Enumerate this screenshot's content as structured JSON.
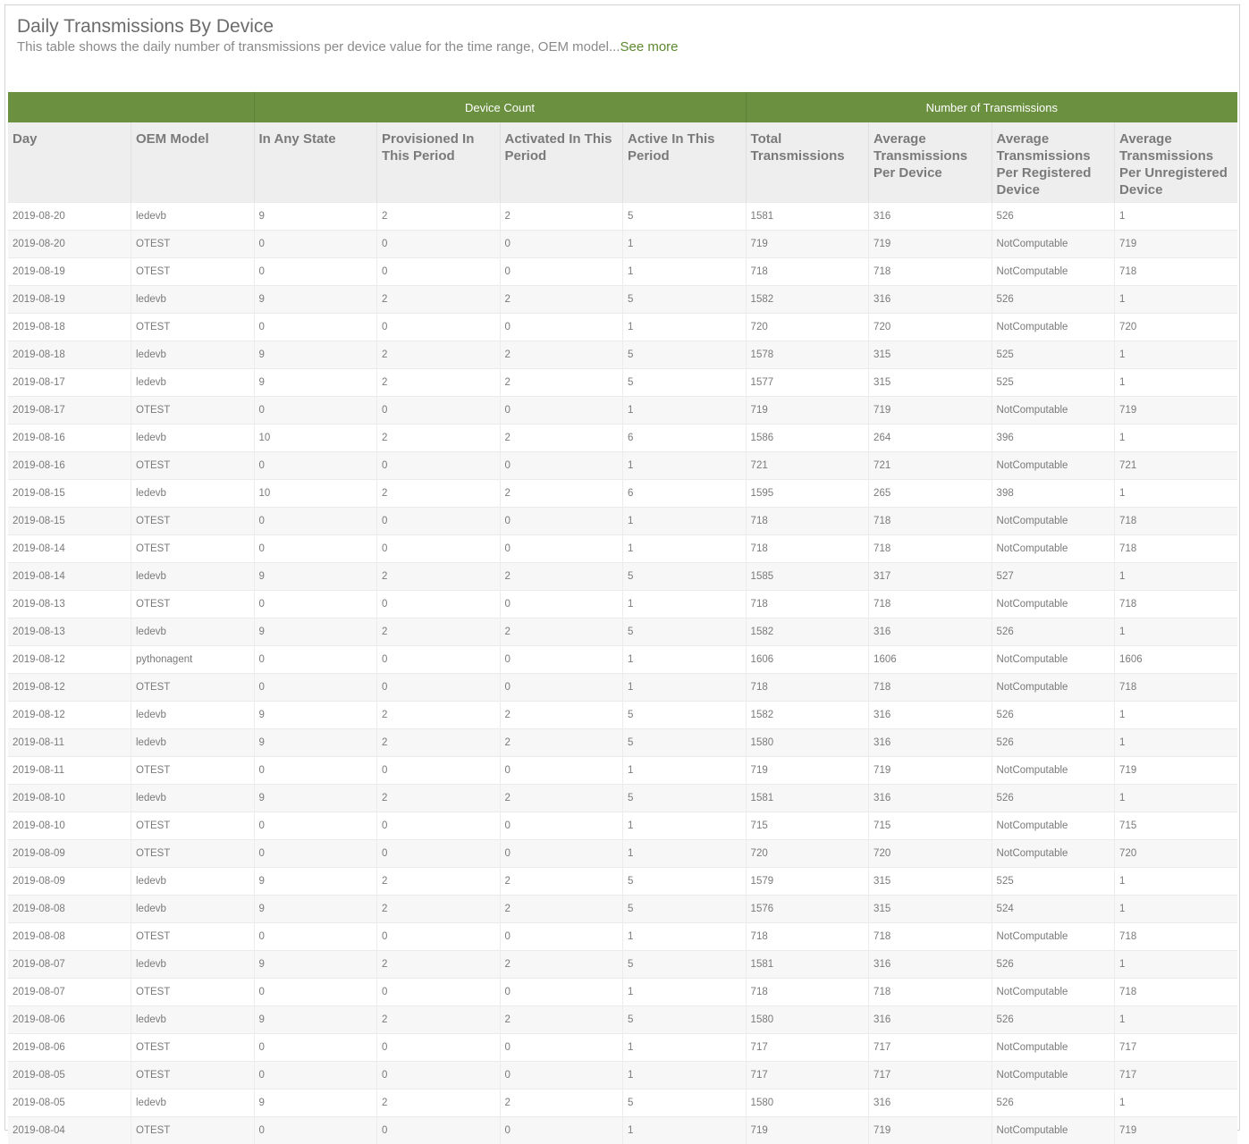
{
  "widget": {
    "title": "Daily Transmissions By Device",
    "description": "This table shows the daily number of transmissions per device value for the time range, OEM model...",
    "see_more": "See more"
  },
  "table": {
    "groups": {
      "device_count": "Device Count",
      "transmissions": "Number of Transmissions"
    },
    "columns": [
      "Day",
      "OEM Model",
      "In Any State",
      "Provisioned In This Period",
      "Activated In This Period",
      "Active In This Period",
      "Total Transmissions",
      "Average Transmissions Per Device",
      "Average Transmissions Per Registered Device",
      "Average Transmissions Per Unregistered Device"
    ],
    "rows": [
      [
        "2019-08-20",
        "ledevb",
        "9",
        "2",
        "2",
        "5",
        "1581",
        "316",
        "526",
        "1"
      ],
      [
        "2019-08-20",
        "OTEST",
        "0",
        "0",
        "0",
        "1",
        "719",
        "719",
        "NotComputable",
        "719"
      ],
      [
        "2019-08-19",
        "OTEST",
        "0",
        "0",
        "0",
        "1",
        "718",
        "718",
        "NotComputable",
        "718"
      ],
      [
        "2019-08-19",
        "ledevb",
        "9",
        "2",
        "2",
        "5",
        "1582",
        "316",
        "526",
        "1"
      ],
      [
        "2019-08-18",
        "OTEST",
        "0",
        "0",
        "0",
        "1",
        "720",
        "720",
        "NotComputable",
        "720"
      ],
      [
        "2019-08-18",
        "ledevb",
        "9",
        "2",
        "2",
        "5",
        "1578",
        "315",
        "525",
        "1"
      ],
      [
        "2019-08-17",
        "ledevb",
        "9",
        "2",
        "2",
        "5",
        "1577",
        "315",
        "525",
        "1"
      ],
      [
        "2019-08-17",
        "OTEST",
        "0",
        "0",
        "0",
        "1",
        "719",
        "719",
        "NotComputable",
        "719"
      ],
      [
        "2019-08-16",
        "ledevb",
        "10",
        "2",
        "2",
        "6",
        "1586",
        "264",
        "396",
        "1"
      ],
      [
        "2019-08-16",
        "OTEST",
        "0",
        "0",
        "0",
        "1",
        "721",
        "721",
        "NotComputable",
        "721"
      ],
      [
        "2019-08-15",
        "ledevb",
        "10",
        "2",
        "2",
        "6",
        "1595",
        "265",
        "398",
        "1"
      ],
      [
        "2019-08-15",
        "OTEST",
        "0",
        "0",
        "0",
        "1",
        "718",
        "718",
        "NotComputable",
        "718"
      ],
      [
        "2019-08-14",
        "OTEST",
        "0",
        "0",
        "0",
        "1",
        "718",
        "718",
        "NotComputable",
        "718"
      ],
      [
        "2019-08-14",
        "ledevb",
        "9",
        "2",
        "2",
        "5",
        "1585",
        "317",
        "527",
        "1"
      ],
      [
        "2019-08-13",
        "OTEST",
        "0",
        "0",
        "0",
        "1",
        "718",
        "718",
        "NotComputable",
        "718"
      ],
      [
        "2019-08-13",
        "ledevb",
        "9",
        "2",
        "2",
        "5",
        "1582",
        "316",
        "526",
        "1"
      ],
      [
        "2019-08-12",
        "pythonagent",
        "0",
        "0",
        "0",
        "1",
        "1606",
        "1606",
        "NotComputable",
        "1606"
      ],
      [
        "2019-08-12",
        "OTEST",
        "0",
        "0",
        "0",
        "1",
        "718",
        "718",
        "NotComputable",
        "718"
      ],
      [
        "2019-08-12",
        "ledevb",
        "9",
        "2",
        "2",
        "5",
        "1582",
        "316",
        "526",
        "1"
      ],
      [
        "2019-08-11",
        "ledevb",
        "9",
        "2",
        "2",
        "5",
        "1580",
        "316",
        "526",
        "1"
      ],
      [
        "2019-08-11",
        "OTEST",
        "0",
        "0",
        "0",
        "1",
        "719",
        "719",
        "NotComputable",
        "719"
      ],
      [
        "2019-08-10",
        "ledevb",
        "9",
        "2",
        "2",
        "5",
        "1581",
        "316",
        "526",
        "1"
      ],
      [
        "2019-08-10",
        "OTEST",
        "0",
        "0",
        "0",
        "1",
        "715",
        "715",
        "NotComputable",
        "715"
      ],
      [
        "2019-08-09",
        "OTEST",
        "0",
        "0",
        "0",
        "1",
        "720",
        "720",
        "NotComputable",
        "720"
      ],
      [
        "2019-08-09",
        "ledevb",
        "9",
        "2",
        "2",
        "5",
        "1579",
        "315",
        "525",
        "1"
      ],
      [
        "2019-08-08",
        "ledevb",
        "9",
        "2",
        "2",
        "5",
        "1576",
        "315",
        "524",
        "1"
      ],
      [
        "2019-08-08",
        "OTEST",
        "0",
        "0",
        "0",
        "1",
        "718",
        "718",
        "NotComputable",
        "718"
      ],
      [
        "2019-08-07",
        "ledevb",
        "9",
        "2",
        "2",
        "5",
        "1581",
        "316",
        "526",
        "1"
      ],
      [
        "2019-08-07",
        "OTEST",
        "0",
        "0",
        "0",
        "1",
        "718",
        "718",
        "NotComputable",
        "718"
      ],
      [
        "2019-08-06",
        "ledevb",
        "9",
        "2",
        "2",
        "5",
        "1580",
        "316",
        "526",
        "1"
      ],
      [
        "2019-08-06",
        "OTEST",
        "0",
        "0",
        "0",
        "1",
        "717",
        "717",
        "NotComputable",
        "717"
      ],
      [
        "2019-08-05",
        "OTEST",
        "0",
        "0",
        "0",
        "1",
        "717",
        "717",
        "NotComputable",
        "717"
      ],
      [
        "2019-08-05",
        "ledevb",
        "9",
        "2",
        "2",
        "5",
        "1580",
        "316",
        "526",
        "1"
      ],
      [
        "2019-08-04",
        "OTEST",
        "0",
        "0",
        "0",
        "1",
        "719",
        "719",
        "NotComputable",
        "719"
      ]
    ]
  },
  "colors": {
    "header_green": "#6b9140",
    "link_green": "#5c8a2e",
    "column_header_bg": "#eeeeee"
  }
}
